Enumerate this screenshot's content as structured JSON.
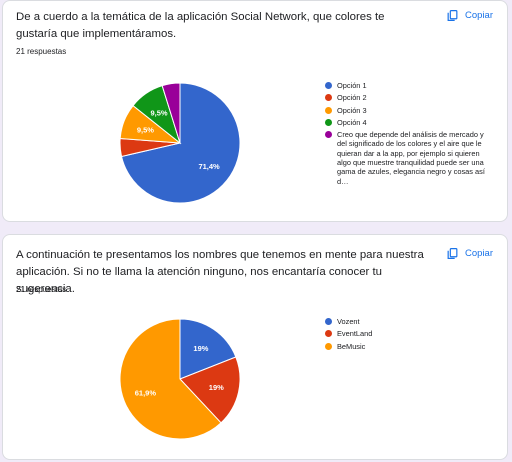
{
  "questions": [
    {
      "title": "De a cuerdo a la temática de la aplicación Social Network, que colores te gustaría que implementáramos.",
      "responses": "21 respuestas",
      "copy_label": "Copiar"
    },
    {
      "title": "A continuación te presentamos los nombres que tenemos en mente para nuestra aplicación. Si no te llama la atención ninguno, nos encantaría conocer tu sugerencia.",
      "responses": "21 respuestas",
      "copy_label": "Copiar"
    }
  ],
  "chart_data": [
    {
      "type": "pie",
      "series": [
        {
          "label": "Opción 1",
          "value": 71.4,
          "data_label": "71,4%",
          "color": "#3366cc"
        },
        {
          "label": "Opción 2",
          "value": 4.8,
          "data_label": "",
          "color": "#dc3912"
        },
        {
          "label": "Opción 3",
          "value": 9.5,
          "data_label": "9,5%",
          "color": "#ff9900"
        },
        {
          "label": "Opción 4",
          "value": 9.5,
          "data_label": "9,5%",
          "color": "#109618"
        },
        {
          "label": "Creo que depende del análisis de mercado y del significado de los colores y el aire que le quieran dar a la app, por ejemplo si quieren algo que muestre tranquilidad puede ser una gama de azules, elegancia negro y cosas así d…",
          "value": 4.8,
          "data_label": "",
          "color": "#990099"
        }
      ],
      "legend_position": "right"
    },
    {
      "type": "pie",
      "series": [
        {
          "label": "Vozent",
          "value": 19,
          "data_label": "19%",
          "color": "#3366cc"
        },
        {
          "label": "EventLand",
          "value": 19,
          "data_label": "19%",
          "color": "#dc3912"
        },
        {
          "label": "BeMusic",
          "value": 61.9,
          "data_label": "61,9%",
          "color": "#ff9900"
        }
      ],
      "legend_position": "right"
    }
  ]
}
